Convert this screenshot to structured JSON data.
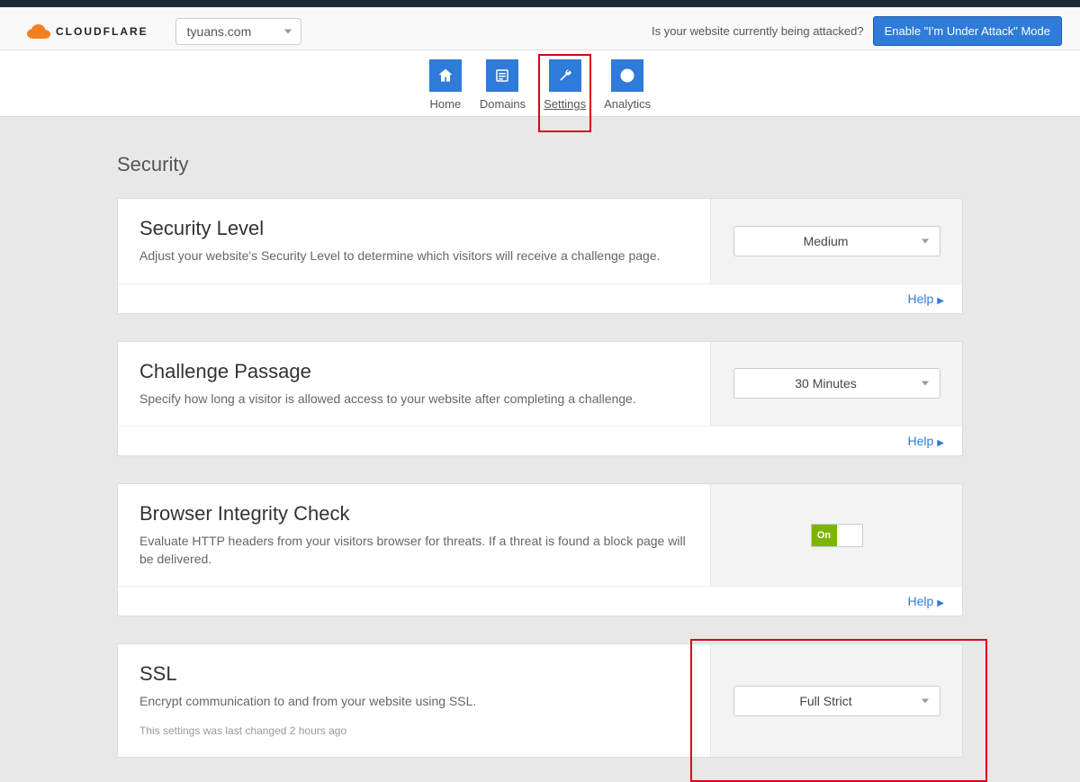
{
  "brand": "CLOUDFLARE",
  "domain": "tyuans.com",
  "attack_prompt": "Is your website currently being attacked?",
  "attack_button": "Enable \"I'm Under Attack\" Mode",
  "nav": {
    "home": "Home",
    "domains": "Domains",
    "settings": "Settings",
    "analytics": "Analytics"
  },
  "section": "Security",
  "cards": {
    "security_level": {
      "title": "Security Level",
      "desc": "Adjust your website's Security Level to determine which visitors will receive a challenge page.",
      "value": "Medium",
      "help": "Help"
    },
    "challenge": {
      "title": "Challenge Passage",
      "desc": "Specify how long a visitor is allowed access to your website after completing a challenge.",
      "value": "30 Minutes",
      "help": "Help"
    },
    "bic": {
      "title": "Browser Integrity Check",
      "desc": "Evaluate HTTP headers from your visitors browser for threats. If a threat is found a block page will be delivered.",
      "toggle": "On",
      "help": "Help"
    },
    "ssl": {
      "title": "SSL",
      "desc": "Encrypt communication to and from your website using SSL.",
      "meta": "This settings was last changed 2 hours ago",
      "value": "Full Strict"
    }
  }
}
